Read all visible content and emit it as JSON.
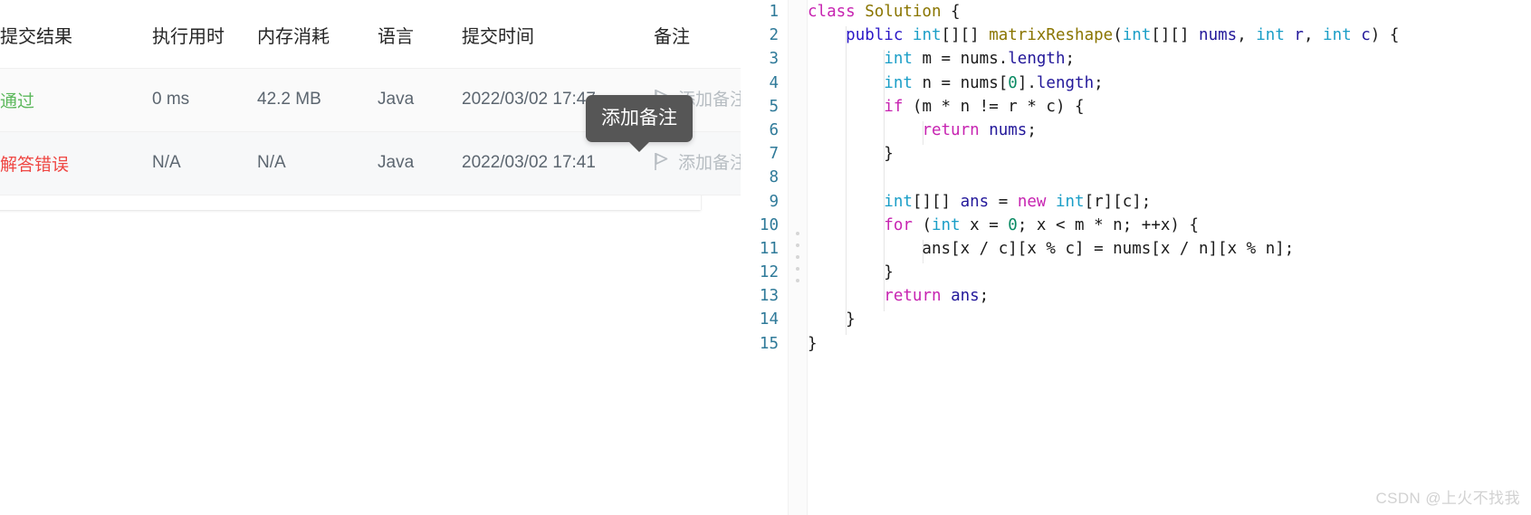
{
  "submissions": {
    "columns": [
      {
        "key": "result",
        "label": "提交结果"
      },
      {
        "key": "runtime",
        "label": "执行用时"
      },
      {
        "key": "memory",
        "label": "内存消耗"
      },
      {
        "key": "lang",
        "label": "语言"
      },
      {
        "key": "time",
        "label": "提交时间"
      },
      {
        "key": "note",
        "label": "备注"
      }
    ],
    "rows": [
      {
        "result": "通过",
        "result_state": "accepted",
        "result_color": "#5cb85c",
        "runtime": "0 ms",
        "memory": "42.2 MB",
        "lang": "Java",
        "time": "2022/03/02 17:47",
        "note_label": "添加备注",
        "note_icon": "flag-icon"
      },
      {
        "result": "解答错误",
        "result_state": "wrong-answer",
        "result_color": "#ef4743",
        "runtime": "N/A",
        "memory": "N/A",
        "lang": "Java",
        "time": "2022/03/02 17:41",
        "note_label": "添加备注",
        "note_icon": "flag-icon"
      }
    ],
    "tooltip": {
      "text": "添加备注",
      "background": "#565656",
      "text_color": "#ffffff"
    }
  },
  "editor": {
    "language": "Java",
    "line_numbers": [
      "1",
      "2",
      "3",
      "4",
      "5",
      "6",
      "7",
      "8",
      "9",
      "10",
      "11",
      "12",
      "13",
      "14",
      "15"
    ],
    "lines": [
      [
        {
          "t": "class ",
          "c": "tok-kw"
        },
        {
          "t": "Solution ",
          "c": "tok-fn"
        },
        {
          "t": "{",
          "c": "tok-pl"
        }
      ],
      [
        {
          "t": "    ",
          "c": "tok-pl"
        },
        {
          "t": "public ",
          "c": "tok-mod"
        },
        {
          "t": "int",
          "c": "tok-type"
        },
        {
          "t": "[][] ",
          "c": "tok-pl"
        },
        {
          "t": "matrixReshape",
          "c": "tok-fn"
        },
        {
          "t": "(",
          "c": "tok-pl"
        },
        {
          "t": "int",
          "c": "tok-type"
        },
        {
          "t": "[][] ",
          "c": "tok-pl"
        },
        {
          "t": "nums",
          "c": "tok-var"
        },
        {
          "t": ", ",
          "c": "tok-pl"
        },
        {
          "t": "int",
          "c": "tok-type"
        },
        {
          "t": " ",
          "c": "tok-pl"
        },
        {
          "t": "r",
          "c": "tok-var"
        },
        {
          "t": ", ",
          "c": "tok-pl"
        },
        {
          "t": "int",
          "c": "tok-type"
        },
        {
          "t": " ",
          "c": "tok-pl"
        },
        {
          "t": "c",
          "c": "tok-var"
        },
        {
          "t": ") {",
          "c": "tok-pl"
        }
      ],
      [
        {
          "t": "        ",
          "c": "tok-pl"
        },
        {
          "t": "int",
          "c": "tok-type"
        },
        {
          "t": " m = nums.",
          "c": "tok-pl"
        },
        {
          "t": "length",
          "c": "tok-var"
        },
        {
          "t": ";",
          "c": "tok-pl"
        }
      ],
      [
        {
          "t": "        ",
          "c": "tok-pl"
        },
        {
          "t": "int",
          "c": "tok-type"
        },
        {
          "t": " n = nums[",
          "c": "tok-pl"
        },
        {
          "t": "0",
          "c": "tok-num"
        },
        {
          "t": "].",
          "c": "tok-pl"
        },
        {
          "t": "length",
          "c": "tok-var"
        },
        {
          "t": ";",
          "c": "tok-pl"
        }
      ],
      [
        {
          "t": "        ",
          "c": "tok-pl"
        },
        {
          "t": "if",
          "c": "tok-kw"
        },
        {
          "t": " (m * n != r * c) {",
          "c": "tok-pl"
        }
      ],
      [
        {
          "t": "            ",
          "c": "tok-pl"
        },
        {
          "t": "return",
          "c": "tok-kw"
        },
        {
          "t": " ",
          "c": "tok-pl"
        },
        {
          "t": "nums",
          "c": "tok-var"
        },
        {
          "t": ";",
          "c": "tok-pl"
        }
      ],
      [
        {
          "t": "        }",
          "c": "tok-pl"
        }
      ],
      [
        {
          "t": "",
          "c": "tok-pl"
        }
      ],
      [
        {
          "t": "        ",
          "c": "tok-pl"
        },
        {
          "t": "int",
          "c": "tok-type"
        },
        {
          "t": "[][] ",
          "c": "tok-pl"
        },
        {
          "t": "ans",
          "c": "tok-var"
        },
        {
          "t": " = ",
          "c": "tok-pl"
        },
        {
          "t": "new",
          "c": "tok-kw"
        },
        {
          "t": " ",
          "c": "tok-pl"
        },
        {
          "t": "int",
          "c": "tok-type"
        },
        {
          "t": "[r][c];",
          "c": "tok-pl"
        }
      ],
      [
        {
          "t": "        ",
          "c": "tok-pl"
        },
        {
          "t": "for",
          "c": "tok-kw"
        },
        {
          "t": " (",
          "c": "tok-pl"
        },
        {
          "t": "int",
          "c": "tok-type"
        },
        {
          "t": " x = ",
          "c": "tok-pl"
        },
        {
          "t": "0",
          "c": "tok-num"
        },
        {
          "t": "; x < m * n; ++x) {",
          "c": "tok-pl"
        }
      ],
      [
        {
          "t": "            ans[x / c][x % c] = nums[x / n][x % n];",
          "c": "tok-pl"
        }
      ],
      [
        {
          "t": "        }",
          "c": "tok-pl"
        }
      ],
      [
        {
          "t": "        ",
          "c": "tok-pl"
        },
        {
          "t": "return",
          "c": "tok-kw"
        },
        {
          "t": " ",
          "c": "tok-pl"
        },
        {
          "t": "ans",
          "c": "tok-var"
        },
        {
          "t": ";",
          "c": "tok-pl"
        }
      ],
      [
        {
          "t": "    }",
          "c": "tok-pl"
        }
      ],
      [
        {
          "t": "}",
          "c": "tok-pl"
        }
      ]
    ]
  },
  "watermark": {
    "text": "CSDN @上火不找我"
  }
}
